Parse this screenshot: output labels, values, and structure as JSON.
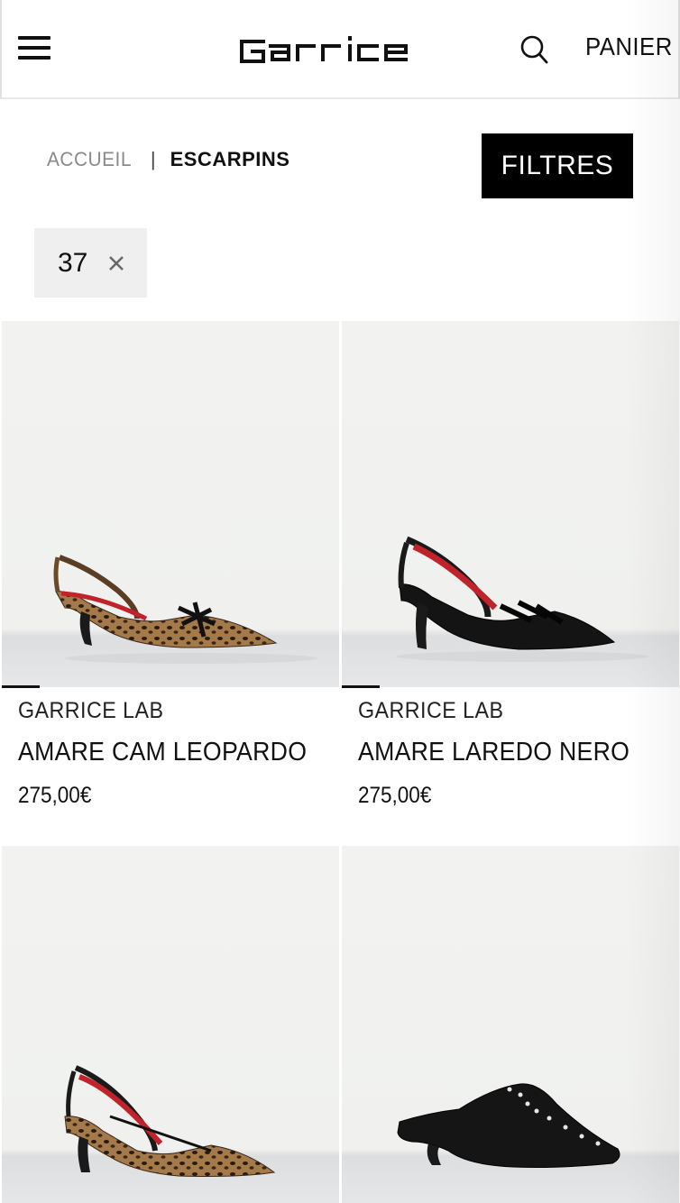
{
  "header": {
    "brand_logo": "Garrice",
    "cart_label": "PANIER",
    "icons": [
      "menu-icon",
      "search-icon"
    ]
  },
  "breadcrumb": {
    "home": "ACCUEIL",
    "separator": "|",
    "current": "ESCARPINS"
  },
  "filters_button": "FILTRES",
  "active_filter": {
    "label": "37",
    "icon": "close-icon"
  },
  "products": [
    {
      "brand": "GARRICE LAB",
      "name": "AMARE CAM LEOPARDO",
      "price": "275,00€",
      "image": "leopard-slingback-shoe"
    },
    {
      "brand": "GARRICE LAB",
      "name": "AMARE LAREDO NERO",
      "price": "275,00€",
      "image": "black-slingback-shoe"
    },
    {
      "brand": "",
      "name": "",
      "price": "",
      "image": "leopard-slingback-black-trim-shoe"
    },
    {
      "brand": "",
      "name": "",
      "price": "",
      "image": "black-lace-up-mule"
    }
  ],
  "colors": {
    "accent": "#000000",
    "chip_bg": "#efefef",
    "muted_text": "#8a8a8a"
  }
}
